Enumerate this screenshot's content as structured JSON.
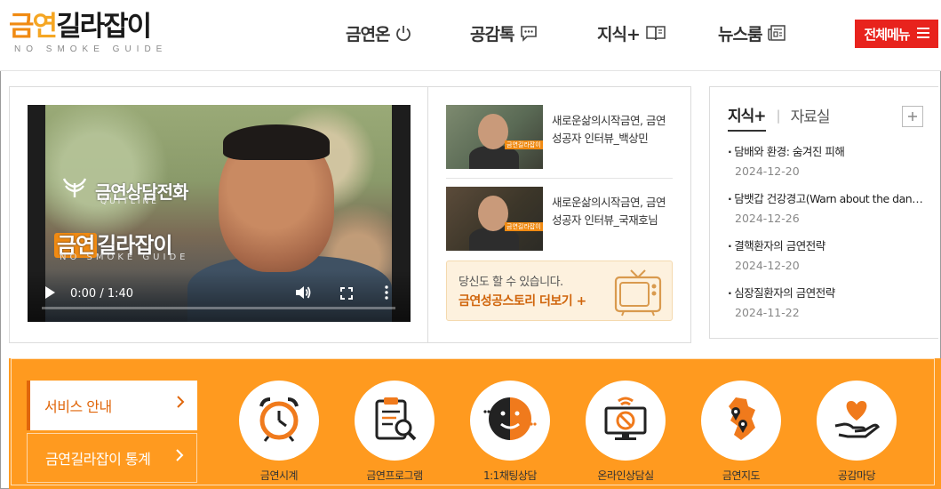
{
  "logo": {
    "main_1": "금",
    "main_2": "연",
    "main_3": "길라잡이",
    "sub": "NO SMOKE GUIDE"
  },
  "nav": [
    {
      "label": "금연온",
      "icon": "power-icon"
    },
    {
      "label": "공감톡",
      "icon": "chat-bubble-icon"
    },
    {
      "label": "지식+",
      "icon": "book-icon"
    },
    {
      "label": "뉴스룸",
      "icon": "newspaper-icon"
    }
  ],
  "menu_button": {
    "label": "전체메뉴",
    "icon": "hamburger-icon"
  },
  "video": {
    "overlay_phone": "금연상담전화",
    "overlay_phone_en": "QUITLINE",
    "overlay_logo_badge": "금연",
    "overlay_logo_rest": "길라잡이",
    "overlay_logo_sub": "NO SMOKE GUIDE",
    "time": "0:00 / 1:40"
  },
  "stories": [
    {
      "title": "새로운삶의시작금연, 금연성공자 인터뷰_백상민",
      "thumb_tag": "금연길라잡이"
    },
    {
      "title": "새로운삶의시작금연, 금연성공자 인터뷰_국재호님",
      "thumb_tag": "금연길라잡이"
    }
  ],
  "promo": {
    "subtitle": "당신도 할 수 있습니다.",
    "title": "금연성공스토리 더보기 +",
    "icon": "tv-icon"
  },
  "knowledge": {
    "tab_active": "지식+",
    "tab_other": "자료실",
    "items": [
      {
        "title": "담배와 환경: 숨겨진 피해",
        "date": "2024-12-20"
      },
      {
        "title": "담뱃갑 건강경고(Warn about the dangers of tobacco)",
        "date": "2024-12-26"
      },
      {
        "title": "결핵환자의 금연전략",
        "date": "2024-12-20"
      },
      {
        "title": "심장질환자의 금연전략",
        "date": "2024-11-22"
      }
    ]
  },
  "services": {
    "tab_active": "서비스 안내",
    "tab_other": "금연길라잡이 통계",
    "items": [
      {
        "label": "금연시계",
        "icon": "alarm-clock-icon"
      },
      {
        "label": "금연프로그램",
        "icon": "clipboard-search-icon"
      },
      {
        "label": "1:1채팅상담",
        "icon": "chat-face-icon"
      },
      {
        "label": "온라인상담실",
        "icon": "no-smoking-monitor-icon"
      },
      {
        "label": "금연지도",
        "icon": "map-pin-icon"
      },
      {
        "label": "공감마당",
        "icon": "heart-hand-icon"
      }
    ]
  },
  "colors": {
    "brand_orange": "#ff9a1f",
    "accent_red": "#e8231d",
    "text_orange": "#e0660a"
  }
}
